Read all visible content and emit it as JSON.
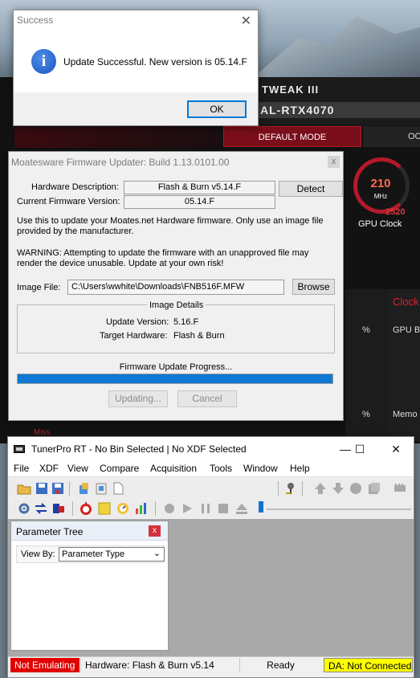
{
  "gpu_app": {
    "title": "TWEAK III",
    "model": "AL-RTX4070",
    "mode_active": "DEFAULT MODE",
    "mode_other": "OC",
    "dial_value": "210",
    "dial_unit": "MHz",
    "dial_max": "2520",
    "dial_label": "GPU Clock",
    "clock_label": "Clock",
    "boost_label": "GPU Bo",
    "memo_label": "Memo",
    "pct1": "%",
    "pct2": "%",
    "pct3": "%",
    "miss": "Miss"
  },
  "success_dialog": {
    "title": "Success",
    "close_glyph": "✕",
    "icon": "info-icon",
    "message": "Update Successful. New version is 05.14.F",
    "ok_label": "OK"
  },
  "firmware_updater": {
    "title": "Moatesware Firmware Updater: Build 1.13.0101.00",
    "close_glyph": "x",
    "hw_desc_label": "Hardware Description:",
    "hw_desc_value": "Flash & Burn v5.14.F",
    "fw_version_label": "Current Firmware Version:",
    "fw_version_value": "05.14.F",
    "detect_label": "Detect",
    "info_text": "Use this to update your Moates.net Hardware firmware. Only use an image file provided by the manufacturer.",
    "warning_text": "WARNING: Attempting to update the firmware with an unapproved file may render the device unusable. Update at your own risk!",
    "image_file_label": "Image File:",
    "image_file_value": "C:\\Users\\wwhite\\Downloads\\FNB516F.MFW",
    "browse_label": "Browse",
    "details_title": "Image Details",
    "update_version_label": "Update Version:",
    "update_version_value": "5.16.F",
    "target_hw_label": "Target Hardware:",
    "target_hw_value": "Flash & Burn",
    "progress_title": "Firmware Update Progress...",
    "progress_fraction": 1.0,
    "updating_label": "Updating...",
    "cancel_label": "Cancel"
  },
  "tunerpro": {
    "title": "TunerPro RT - No Bin Selected | No XDF Selected",
    "minimize_glyph": "—",
    "maximize_glyph": "☐",
    "close_glyph": "✕",
    "menu": [
      "File",
      "XDF",
      "View",
      "Compare",
      "Acquisition",
      "Tools",
      "Window",
      "Help"
    ],
    "parameter_tree": {
      "title": "Parameter Tree",
      "close_glyph": "x",
      "view_by_label": "View By:",
      "view_by_value": "Parameter Type"
    },
    "status": {
      "emulation": "Not Emulating",
      "hardware": "Hardware: Flash & Burn v5.14",
      "state": "Ready",
      "da": "DA: Not Connected"
    },
    "colors": {
      "emulation_bg": "#e00000",
      "da_bg": "#ffff00",
      "progress_fill": "#0f78d4"
    }
  }
}
